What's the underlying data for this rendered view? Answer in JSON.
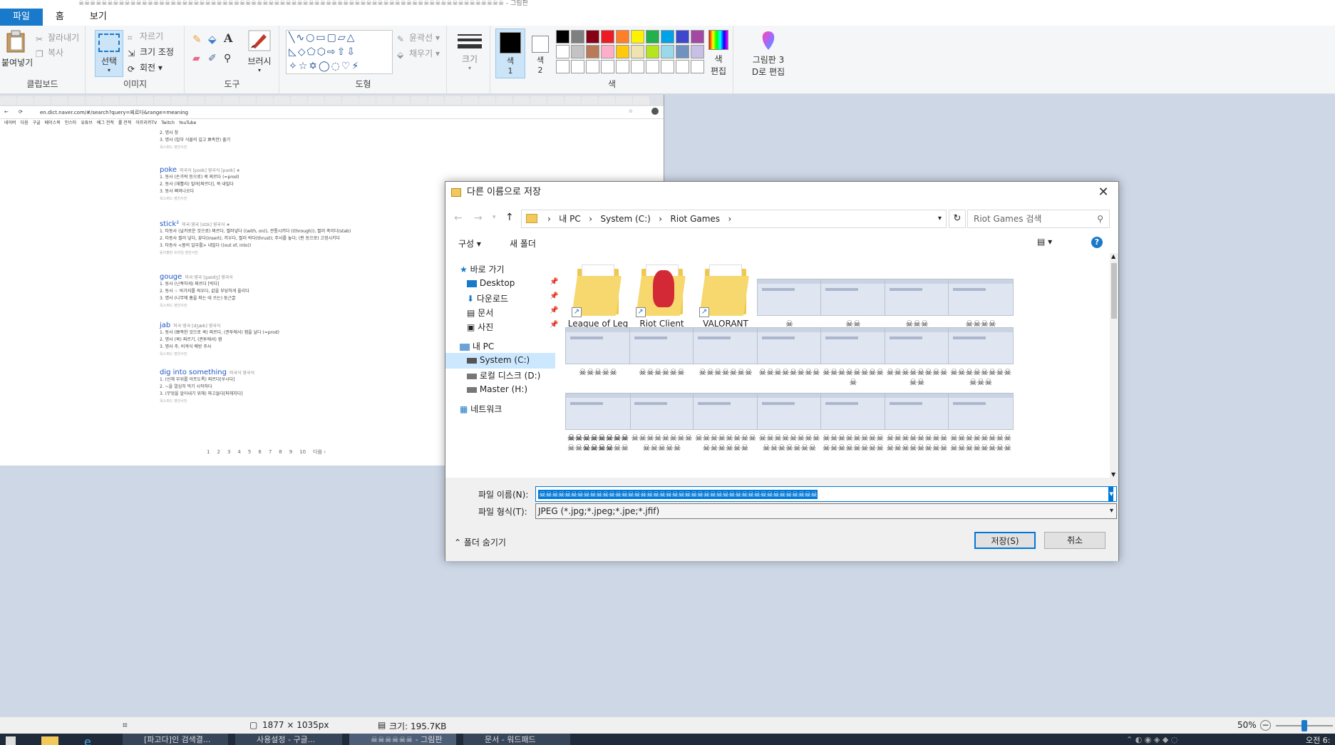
{
  "window": {
    "title": "☠☠☠☠☠☠☠☠☠☠☠☠☠☠☠☠☠☠☠☠☠☠☠☠☠☠☠☠☠☠☠☠☠☠☠☠☠☠☠☠☠☠☠☠☠☠☠☠☠☠☠☠☠☠☠☠☠☠☠☠☠☠☠☠☠☠☠☠☠☠☠☠☠☠ - 그림판"
  },
  "ribbon": {
    "tabs": [
      "파일",
      "홈",
      "보기"
    ],
    "clipboard": {
      "paste": "붙여넣기",
      "cut": "잘라내기",
      "copy": "복사",
      "label": "클립보드"
    },
    "image": {
      "select": "선택",
      "crop": "자르기",
      "resize": "크기 조정",
      "rotate": "회전",
      "label": "이미지"
    },
    "tools": {
      "label": "도구",
      "brush": "브러시"
    },
    "shapes": {
      "outline": "윤곽선",
      "fill": "채우기",
      "label": "도형"
    },
    "size": {
      "label": "크기"
    },
    "colors": {
      "color1": "색 1",
      "color1_top": "색",
      "color1_bottom": "1",
      "color2": "색 2",
      "color2_top": "색",
      "color2_bottom": "2",
      "edit": "색 편집",
      "edit_top": "색",
      "edit_bottom": "편집",
      "label": "색",
      "palette": [
        "#000000",
        "#7f7f7f",
        "#880015",
        "#ed1c24",
        "#ff7f27",
        "#fff200",
        "#22b14c",
        "#00a2e8",
        "#3f48cc",
        "#a349a4",
        "#ffffff",
        "#c3c3c3",
        "#b97a57",
        "#ffaec9",
        "#ffc90e",
        "#efe4b0",
        "#b5e61d",
        "#99d9ea",
        "#7092be",
        "#c8bfe7"
      ]
    },
    "paint3d": {
      "line1": "그림판 3",
      "line2": "D로 편집"
    }
  },
  "browser": {
    "url": "en.dict.naver.com/#/search?query=찌르다&range=meaning",
    "bookmarks": [
      "네이버",
      "다음",
      "구글",
      "페이스북",
      "인스타",
      "유튜브",
      "배그 전적",
      "롤 전적",
      "아프리카TV",
      "Twitch",
      "YouTube"
    ],
    "entries": [
      {
        "word": "",
        "lines": [
          "2. 명사 창",
          "3. 명사 (밥부 식물의 길고 뾰족한) 줄기"
        ],
        "source": "옥스퍼드 영한사전"
      },
      {
        "word": "poke",
        "pron": "미국식 [poʊk]  영국식 [pəʊk] ★",
        "lines": [
          "1. 동사 (손가락 등으로) 쿡 찌르다 (=prod)",
          "2. 동사 (재빨리) 밀어[찌르다], 쑥 내밀다",
          "3. 동사 삐져나오다"
        ],
        "source": "옥스퍼드 영한사전"
      },
      {
        "word": "stick²",
        "pron": "미국·영국 [stɪk]  영국식 ★",
        "lines": [
          "1. 타동사 (날카로운 것으로) 찌르다, 찔러넣다 ((with, on)), 관통시키다 ((through)), 찔러 죽이다(stab)",
          "2. 타동사 찔러 넣다, 꽂다(insert), 끼우다, 찔러 박다(thrust); 주사를 놓다; (핀 등으로) 고정시키다",
          "3. 타동사 <몸의 일부를> 내밀다 ((out of, into))"
        ],
        "source": "동아출판 프라임 영한사전"
      },
      {
        "word": "gouge",
        "pron": "미국·영국 [gaʊdʒ]  영국식",
        "lines": [
          "1. 동사 (난폭하게) 찌르다 [박다]",
          "2. 동사 ☞ 바가지를 씌우다, 값을 부당하게 올리다",
          "3. 명사 (나무에 홈을 파는 데 쓰는) 둥근끌"
        ],
        "source": "옥스퍼드 영한사전"
      },
      {
        "word": "jab",
        "pron": "미국·영국 [dʒæb]  영국식",
        "lines": [
          "1. 동사 (뾰족한 것으로 쿡) 찌르다, (권투에서) 잽을 날다 (=prod)",
          "2. 명사 (쿡) 찌르기, (권투에서) 잽",
          "3. 명사 주, 비격식 예방 주사"
        ],
        "source": "옥스퍼드 영한사전"
      },
      {
        "word": "dig into something",
        "pron": "미국식  영국식",
        "lines": [
          "1. (신체 부위를 아프도록) 찌르다[쑤시다]",
          "2. ~을 열심히 먹기 시작하다",
          "3. (무엇을 알아내기 위해) 파고들다[파헤치다]"
        ],
        "source": "옥스퍼드 영한사전"
      }
    ],
    "pager": [
      "1",
      "2",
      "3",
      "4",
      "5",
      "6",
      "7",
      "8",
      "9",
      "10",
      "다음 ›"
    ]
  },
  "dialog": {
    "title": "다른 이름으로 저장",
    "breadcrumb": [
      "내 PC",
      "System (C:)",
      "Riot Games"
    ],
    "search_placeholder": "Riot Games 검색",
    "organize": "구성 ▾",
    "new_folder": "새 폴더",
    "nav": {
      "quick": "바로 가기",
      "desktop": "Desktop",
      "downloads": "다운로드",
      "docs": "문서",
      "pictures": "사진",
      "pc": "내 PC",
      "system": "System (C:)",
      "local": "로컬 디스크 (D:)",
      "master": "Master (H:)",
      "network": "네트워크"
    },
    "items": [
      {
        "name": "League of Legends",
        "kind": "folder"
      },
      {
        "name": "Riot Client",
        "kind": "folder"
      },
      {
        "name": "VALORANT",
        "kind": "folder"
      },
      {
        "name": "☠",
        "kind": "image"
      },
      {
        "name": "☠☠",
        "kind": "image"
      },
      {
        "name": "☠☠☠",
        "kind": "image"
      },
      {
        "name": "☠☠☠☠",
        "kind": "image"
      },
      {
        "name": "☠☠☠☠☠",
        "kind": "image"
      },
      {
        "name": "☠☠☠☠☠☠",
        "kind": "image"
      },
      {
        "name": "☠☠☠☠☠☠☠",
        "kind": "image"
      },
      {
        "name": "☠☠☠☠☠☠☠☠",
        "kind": "image"
      },
      {
        "name": "☠☠☠☠☠☠☠☠☠",
        "kind": "image"
      },
      {
        "name": "☠☠☠☠☠☠☠☠☠☠",
        "kind": "image"
      },
      {
        "name": "☠☠☠☠☠☠☠☠☠☠☠",
        "kind": "image"
      },
      {
        "name": "☠☠☠☠☠☠☠☠☠☠☠☠",
        "kind": "image"
      },
      {
        "name": "☠☠☠☠☠☠☠☠☠☠☠☠☠",
        "kind": "image"
      },
      {
        "name": "☠☠☠☠☠☠☠☠☠☠☠☠☠☠",
        "kind": "image"
      },
      {
        "name": "☠☠☠☠☠☠☠☠☠☠☠☠☠☠☠",
        "kind": "image"
      },
      {
        "name": "☠☠☠☠☠☠☠☠☠☠☠☠☠☠☠☠",
        "kind": "image"
      },
      {
        "name": "☠☠☠☠☠☠☠☠☠☠☠☠☠☠☠☠☠",
        "kind": "image"
      },
      {
        "name": "☠☠☠☠☠☠☠☠☠☠☠☠☠☠☠☠☠☠",
        "kind": "image"
      },
      {
        "name": "☠☠☠☠☠☠☠☠☠☠☠☠☠☠☠☠☠☠☠",
        "kind": "image"
      }
    ],
    "filename_label": "파일 이름(N):",
    "filename_value": "☠☠☠☠☠☠☠☠☠☠☠☠☠☠☠☠☠☠☠☠☠☠☠☠☠☠☠☠☠☠☠☠☠☠☠☠☠☠☠☠☠☠☠☠",
    "filetype_label": "파일 형식(T):",
    "filetype_value": "JPEG (*.jpg;*.jpeg;*.jpe;*.jfif)",
    "hide_folders": "폴더 숨기기",
    "save": "저장(S)",
    "cancel": "취소"
  },
  "status": {
    "dimensions": "1877 × 1035px",
    "size": "크기: 195.7KB",
    "zoom": "50%",
    "zoom_level_percent": 50
  },
  "taskbar": {
    "tasks": [
      "[파고다]인 검색결...",
      "사용설정 - 구글...",
      "☠☠☠☠☠☠ - 그림판",
      "문서 - 워드패드"
    ],
    "clock": "오전 6:"
  }
}
